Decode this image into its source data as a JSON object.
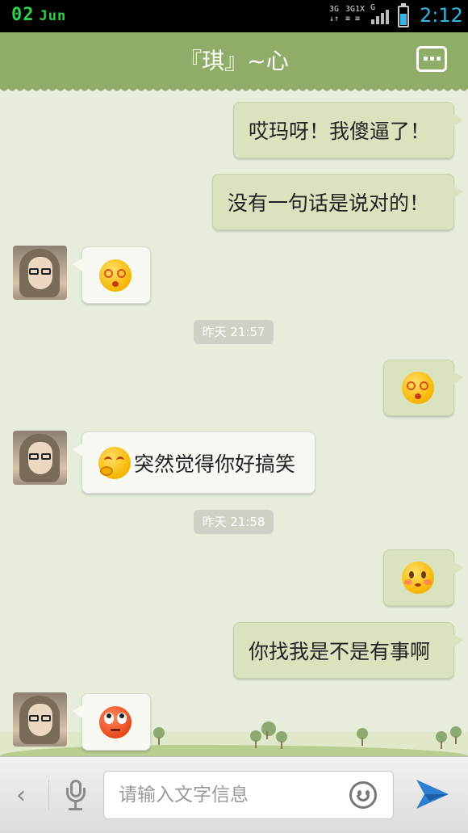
{
  "status_bar": {
    "day": "02",
    "month": "Jun",
    "net_top": "3G 3G 1X G",
    "time": "2:12"
  },
  "header": {
    "title": "『琪』~心",
    "menu_icon": "more-dots-icon",
    "color": "#8fad68"
  },
  "messages": [
    {
      "side": "out",
      "type": "text",
      "text": "哎玛呀！我傻逼了！"
    },
    {
      "side": "out",
      "type": "text",
      "text": "没有一句话是说对的！"
    },
    {
      "side": "in",
      "type": "emoji",
      "emoji": "dizzy-face-emoji"
    },
    {
      "type": "timestamp",
      "text": "昨天 21:57"
    },
    {
      "side": "out",
      "type": "emoji",
      "emoji": "dizzy-face-emoji"
    },
    {
      "side": "in",
      "type": "text",
      "emoji": "laughing-face-emoji",
      "text": "突然觉得你好搞笑"
    },
    {
      "type": "timestamp",
      "text": "昨天 21:58"
    },
    {
      "side": "out",
      "type": "emoji",
      "emoji": "shy-face-emoji"
    },
    {
      "side": "out",
      "type": "text",
      "text": "你找我是不是有事啊"
    },
    {
      "side": "in",
      "type": "emoji",
      "emoji": "rolling-eyes-emoji"
    }
  ],
  "input_bar": {
    "placeholder": "请输入文字信息",
    "send_color": "#2f7fd0"
  }
}
